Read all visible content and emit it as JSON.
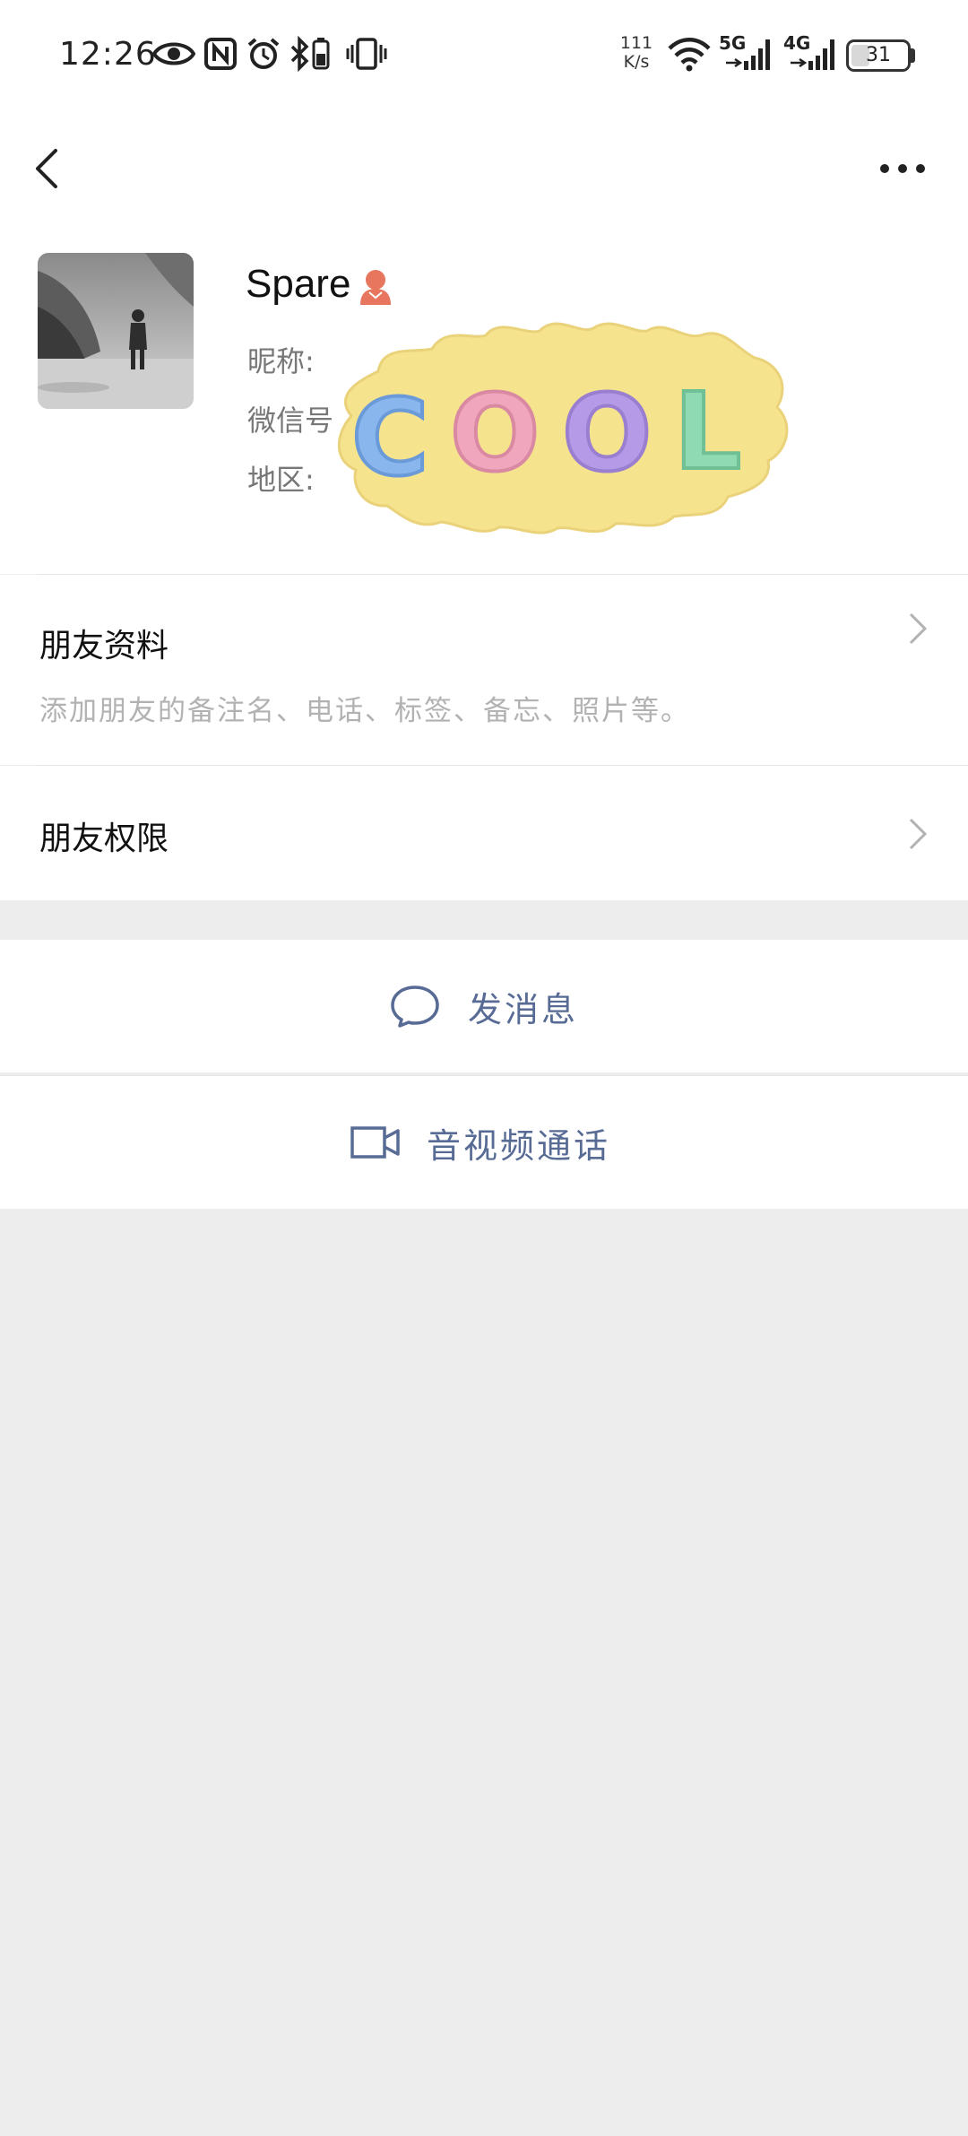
{
  "status_bar": {
    "time": "12:26",
    "net_speed_value": "111",
    "net_speed_unit": "K/s",
    "network_1": "5G",
    "network_2": "4G",
    "battery": "31"
  },
  "profile": {
    "name": "Spare",
    "nickname_label": "昵称:",
    "wechat_id_label": "微信号",
    "region_label": "地区:",
    "sticker_text": "COOL"
  },
  "rows": {
    "friend_info_title": "朋友资料",
    "friend_info_subtitle": "添加朋友的备注名、电话、标签、备忘、照片等。",
    "friend_permissions_title": "朋友权限"
  },
  "actions": {
    "send_message": "发消息",
    "video_call": "音视频通话"
  },
  "colors": {
    "link_blue": "#576b95",
    "background_gray": "#ededed",
    "gender_female": "#e8765f"
  }
}
